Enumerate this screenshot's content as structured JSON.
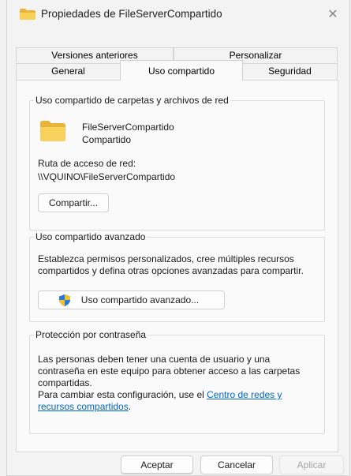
{
  "window": {
    "title": "Propiedades de FileServerCompartido",
    "close_glyph": "✕",
    "icon": "folder-icon"
  },
  "tabs": {
    "row1": [
      {
        "label": "Versiones anteriores"
      },
      {
        "label": "Personalizar"
      }
    ],
    "row2": [
      {
        "label": "General"
      },
      {
        "label": "Uso compartido",
        "active": true
      },
      {
        "label": "Seguridad"
      }
    ]
  },
  "sharing": {
    "group_title": "Uso compartido de carpetas y archivos de red",
    "folder_name": "FileServerCompartido",
    "folder_status": "Compartido",
    "path_label": "Ruta de acceso de red:",
    "path_value": "\\\\VQUINO\\FileServerCompartido",
    "share_button": "Compartir..."
  },
  "advanced": {
    "group_title": "Uso compartido avanzado",
    "description_line1": "Establezca permisos personalizados, cree múltiples recursos",
    "description_line2": "compartidos y defina otras opciones avanzadas para compartir.",
    "button_label": "Uso compartido avanzado...",
    "button_icon": "shield-icon"
  },
  "password": {
    "group_title": "Protección por contraseña",
    "line1": "Las personas deben tener una cuenta de usuario y una",
    "line2": "contraseña en este equipo para obtener acceso a las carpetas",
    "line3": "compartidas.",
    "line4_prefix": "Para cambiar esta configuración, use el ",
    "link_part1": "Centro de redes y",
    "link_part2": "recursos compartidos",
    "line5_suffix": "."
  },
  "footer": {
    "ok": "Aceptar",
    "cancel": "Cancelar",
    "apply": "Aplicar"
  },
  "colors": {
    "link": "#0066cc",
    "folder": "#f6c94a",
    "shield_blue": "#2b78d6",
    "shield_yellow": "#f2c230"
  }
}
